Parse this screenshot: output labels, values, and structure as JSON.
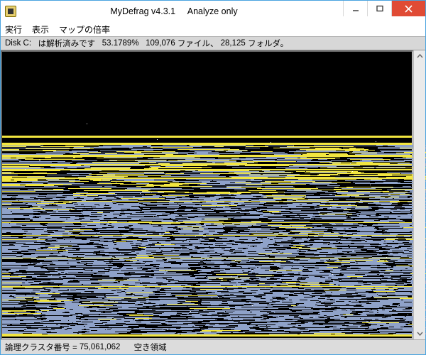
{
  "titlebar": {
    "title": "MyDefrag v4.3.1     Analyze only"
  },
  "menu": {
    "run": "実行",
    "view": "表示",
    "zoom": "マップの倍率"
  },
  "info": {
    "disk_label": "Disk C:",
    "status": "は解析済みです",
    "percent": "53.1789%",
    "files_val": "109,076",
    "files_lbl": "ファイル、",
    "folders_val": "28,125",
    "folders_lbl": "フォルダ。"
  },
  "status": {
    "cluster_label": "論理クラスタ番号 =",
    "cluster_val": "75,061,062",
    "free_label": "空き領域"
  },
  "colors": {
    "yellow": "#f2e640",
    "blue": "#8fa2c9",
    "black": "#000000"
  },
  "icons": {
    "minimize": "minimize-icon",
    "maximize": "maximize-icon",
    "close": "close-icon"
  }
}
